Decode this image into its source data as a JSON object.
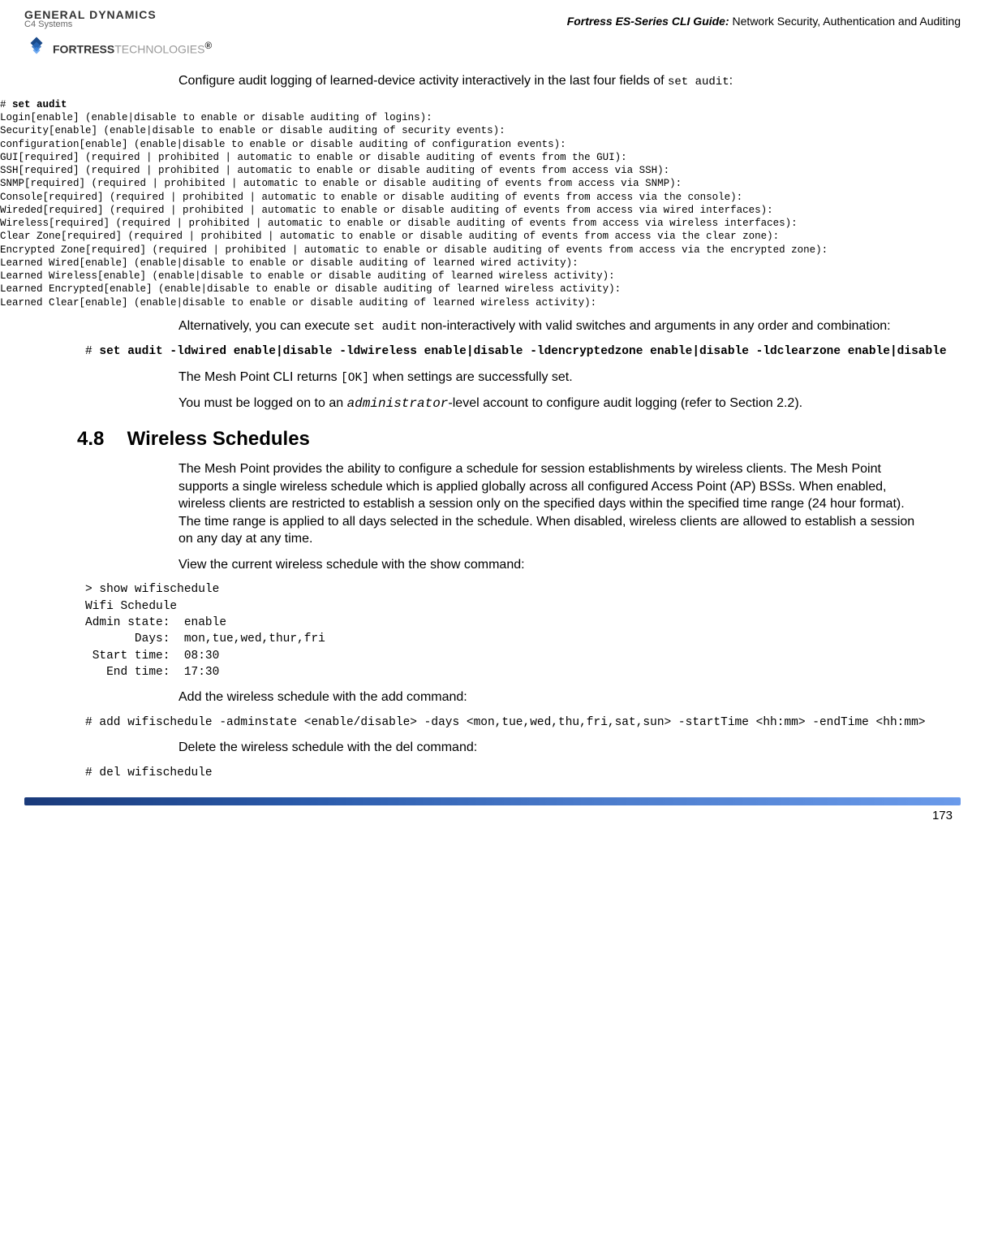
{
  "header": {
    "gd_logo": "GENERAL DYNAMICS",
    "gd_sub": "C4 Systems",
    "fortress_bold": "FORTRESS",
    "fortress_tech": "TECHNOLOGIES",
    "fortress_reg": "®",
    "doc_title": "Fortress ES-Series CLI Guide:",
    "doc_section": " Network Security, Authentication and Auditing"
  },
  "intro": {
    "p1a": "Configure audit logging of learned-device activity interactively in the last four fields of ",
    "p1b": "set audit",
    "p1c": ":"
  },
  "cli1": {
    "hash": "# ",
    "cmd": "set audit",
    "lines": "Login[enable] (enable|disable to enable or disable auditing of logins):\nSecurity[enable] (enable|disable to enable or disable auditing of security events):\nconfiguration[enable] (enable|disable to enable or disable auditing of configuration events):\nGUI[required] (required | prohibited | automatic to enable or disable auditing of events from the GUI):\nSSH[required] (required | prohibited | automatic to enable or disable auditing of events from access via SSH):\nSNMP[required] (required | prohibited | automatic to enable or disable auditing of events from access via SNMP):\nConsole[required] (required | prohibited | automatic to enable or disable auditing of events from access via the console):\nWireded[required] (required | prohibited | automatic to enable or disable auditing of events from access via wired interfaces):\nWireless[required] (required | prohibited | automatic to enable or disable auditing of events from access via wireless interfaces):\nClear Zone[required] (required | prohibited | automatic to enable or disable auditing of events from access via the clear zone):\nEncrypted Zone[required] (required | prohibited | automatic to enable or disable auditing of events from access via the encrypted zone):\nLearned Wired[enable] (enable|disable to enable or disable auditing of learned wired activity):\nLearned Wireless[enable] (enable|disable to enable or disable auditing of learned wireless activity):\nLearned Encrypted[enable] (enable|disable to enable or disable auditing of learned wireless activity):\nLearned Clear[enable] (enable|disable to enable or disable auditing of learned wireless activity):"
  },
  "mid": {
    "p2a": "Alternatively, you can execute ",
    "p2b": "set audit",
    "p2c": " non-interactively with valid switches and arguments in any order and combination:"
  },
  "cli2": {
    "hash": "# ",
    "cmd": "set audit -ldwired enable|disable -ldwireless enable|disable -ldencryptedzone enable|disable -ldclearzone enable|disable"
  },
  "mid2": {
    "p3a": "The Mesh Point CLI returns ",
    "p3b": "[OK]",
    "p3c": " when settings are successfully set.",
    "p4a": "You must be logged on to an ",
    "p4b": "administrator",
    "p4c": "-level account to configure audit logging (refer to Section 2.2)."
  },
  "section": {
    "num": "4.8",
    "title": "Wireless Schedules"
  },
  "wireless": {
    "p5": "The Mesh Point provides the ability to configure a schedule for session establishments by wireless clients. The Mesh Point supports a single wireless schedule which is applied globally across all configured Access Point (AP) BSSs. When enabled, wireless clients are restricted to establish a session only on the specified days within the specified time range (24 hour format). The time range is applied to all days selected in the schedule. When disabled, wireless clients are allowed to establish a session on any day at any time.",
    "p6": "View the current wireless schedule with the show command:"
  },
  "cli3": {
    "text": "> show wifischedule\nWifi Schedule\nAdmin state:  enable\n       Days:  mon,tue,wed,thur,fri\n Start time:  08:30\n   End time:  17:30"
  },
  "add": {
    "p7": "Add the wireless schedule with the add command:"
  },
  "cli4": {
    "text": "# add wifischedule -adminstate <enable/disable> -days <mon,tue,wed,thu,fri,sat,sun> -startTime <hh:mm> -endTime <hh:mm>"
  },
  "del": {
    "p8": "Delete the wireless schedule with the del command:"
  },
  "cli5": {
    "text": "# del wifischedule"
  },
  "footer": {
    "page": "173"
  }
}
